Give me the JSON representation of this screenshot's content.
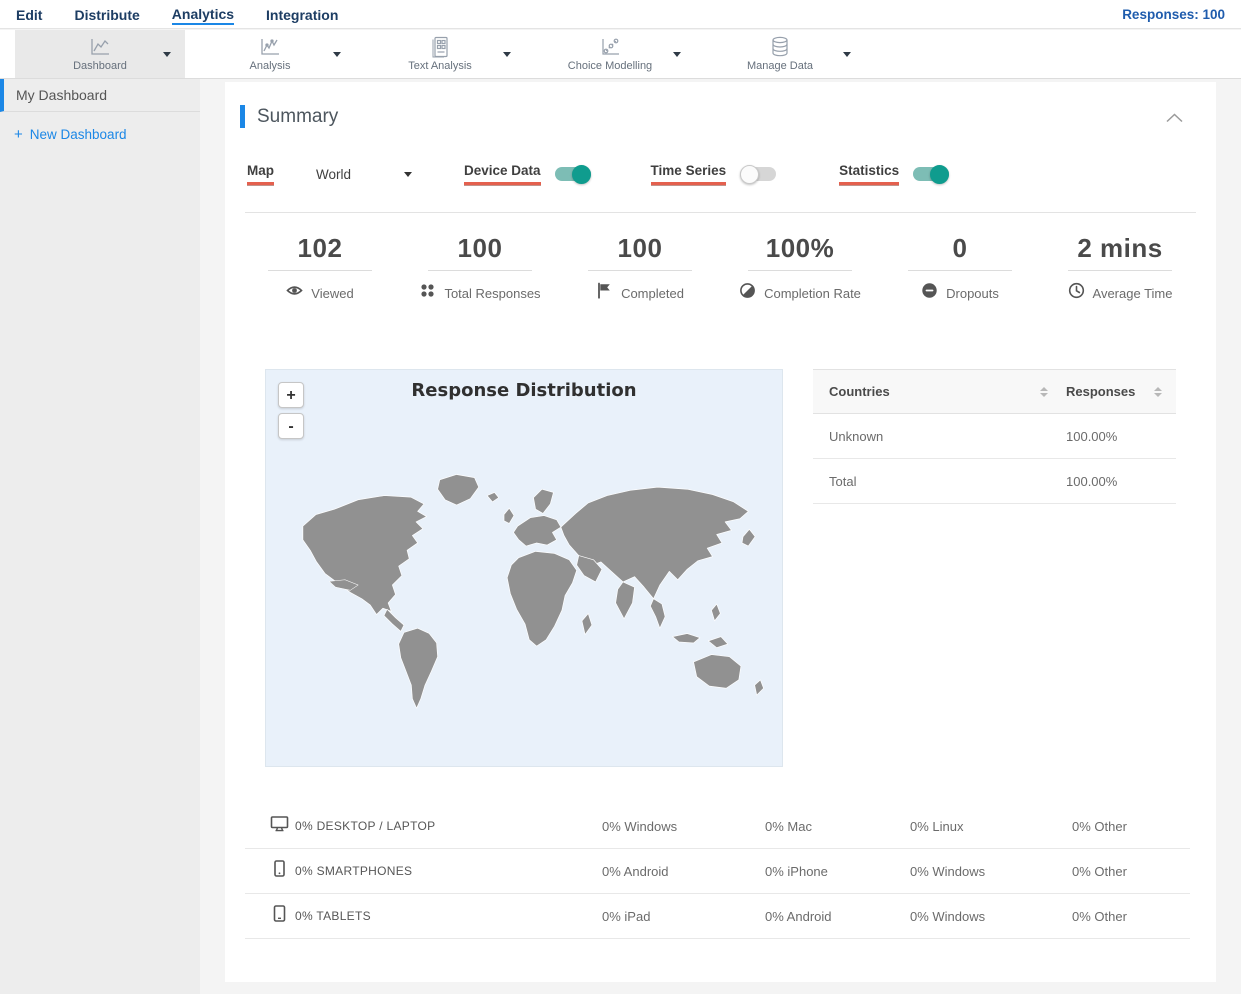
{
  "topnav": {
    "items": [
      {
        "label": "Edit"
      },
      {
        "label": "Distribute"
      },
      {
        "label": "Analytics"
      },
      {
        "label": "Integration"
      }
    ],
    "responses_label": "Responses: 100"
  },
  "toolbar": {
    "items": [
      {
        "label": "Dashboard"
      },
      {
        "label": "Analysis"
      },
      {
        "label": "Text Analysis"
      },
      {
        "label": "Choice Modelling"
      },
      {
        "label": "Manage Data"
      }
    ]
  },
  "sidebar": {
    "active_item": "My Dashboard",
    "plus": "+",
    "new_dashboard_label": "New Dashboard"
  },
  "summary": {
    "title": "Summary",
    "controls": {
      "map_label": "Map",
      "map_value": "World",
      "toggles": [
        {
          "label": "Device Data",
          "on": true
        },
        {
          "label": "Time Series",
          "on": false
        },
        {
          "label": "Statistics",
          "on": true
        }
      ]
    },
    "stats": [
      {
        "value": "102",
        "label": "Viewed"
      },
      {
        "value": "100",
        "label": "Total Responses"
      },
      {
        "value": "100",
        "label": "Completed"
      },
      {
        "value": "100%",
        "label": "Completion Rate"
      },
      {
        "value": "0",
        "label": "Dropouts"
      },
      {
        "value": "2 mins",
        "label": "Average Time"
      }
    ],
    "map": {
      "title": "Response Distribution",
      "zoom_in": "+",
      "zoom_out": "-"
    },
    "countries_table": {
      "col_countries": "Countries",
      "col_responses": "Responses",
      "rows": [
        {
          "country": "Unknown",
          "responses": "100.00%"
        },
        {
          "country": "Total",
          "responses": "100.00%"
        }
      ]
    },
    "devices": [
      {
        "label": "0% DESKTOP / LAPTOP",
        "d1": "0% Windows",
        "d2": "0% Mac",
        "d3": "0% Linux",
        "d4": "0% Other"
      },
      {
        "label": "0% SMARTPHONES",
        "d1": "0% Android",
        "d2": "0% iPhone",
        "d3": "0% Windows",
        "d4": "0% Other"
      },
      {
        "label": "0% TABLETS",
        "d1": "0% iPad",
        "d2": "0% Android",
        "d3": "0% Windows",
        "d4": "0% Other"
      }
    ]
  },
  "colors": {
    "accent_blue": "#1b87e6",
    "nav_navy": "#1d3d63",
    "toggle_on_teal": "#0f9c8e",
    "label_underline_red": "#e4604e",
    "map_land": "#919191",
    "map_ocean": "#e9f1fa"
  }
}
